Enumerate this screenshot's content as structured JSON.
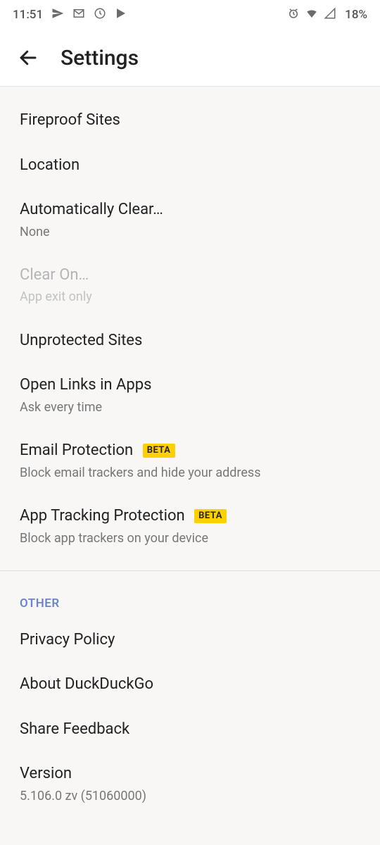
{
  "status": {
    "time": "11:51",
    "battery": "18%"
  },
  "appbar": {
    "title": "Settings"
  },
  "items": {
    "fireproof": {
      "title": "Fireproof Sites"
    },
    "location": {
      "title": "Location"
    },
    "autoclear": {
      "title": "Automatically Clear…",
      "sub": "None"
    },
    "clearon": {
      "title": "Clear On…",
      "sub": "App exit only"
    },
    "unprotected": {
      "title": "Unprotected Sites"
    },
    "openlinks": {
      "title": "Open Links in Apps",
      "sub": "Ask every time"
    },
    "emailprotect": {
      "title": "Email Protection",
      "badge": "BETA",
      "sub": "Block email trackers and hide your address"
    },
    "apptracking": {
      "title": "App Tracking Protection",
      "badge": "BETA",
      "sub": "Block app trackers on your device"
    }
  },
  "section_other": "OTHER",
  "other": {
    "privacy": {
      "title": "Privacy Policy"
    },
    "about": {
      "title": "About DuckDuckGo"
    },
    "feedback": {
      "title": "Share Feedback"
    },
    "version": {
      "title": "Version",
      "sub": "5.106.0 zv (51060000)"
    }
  }
}
